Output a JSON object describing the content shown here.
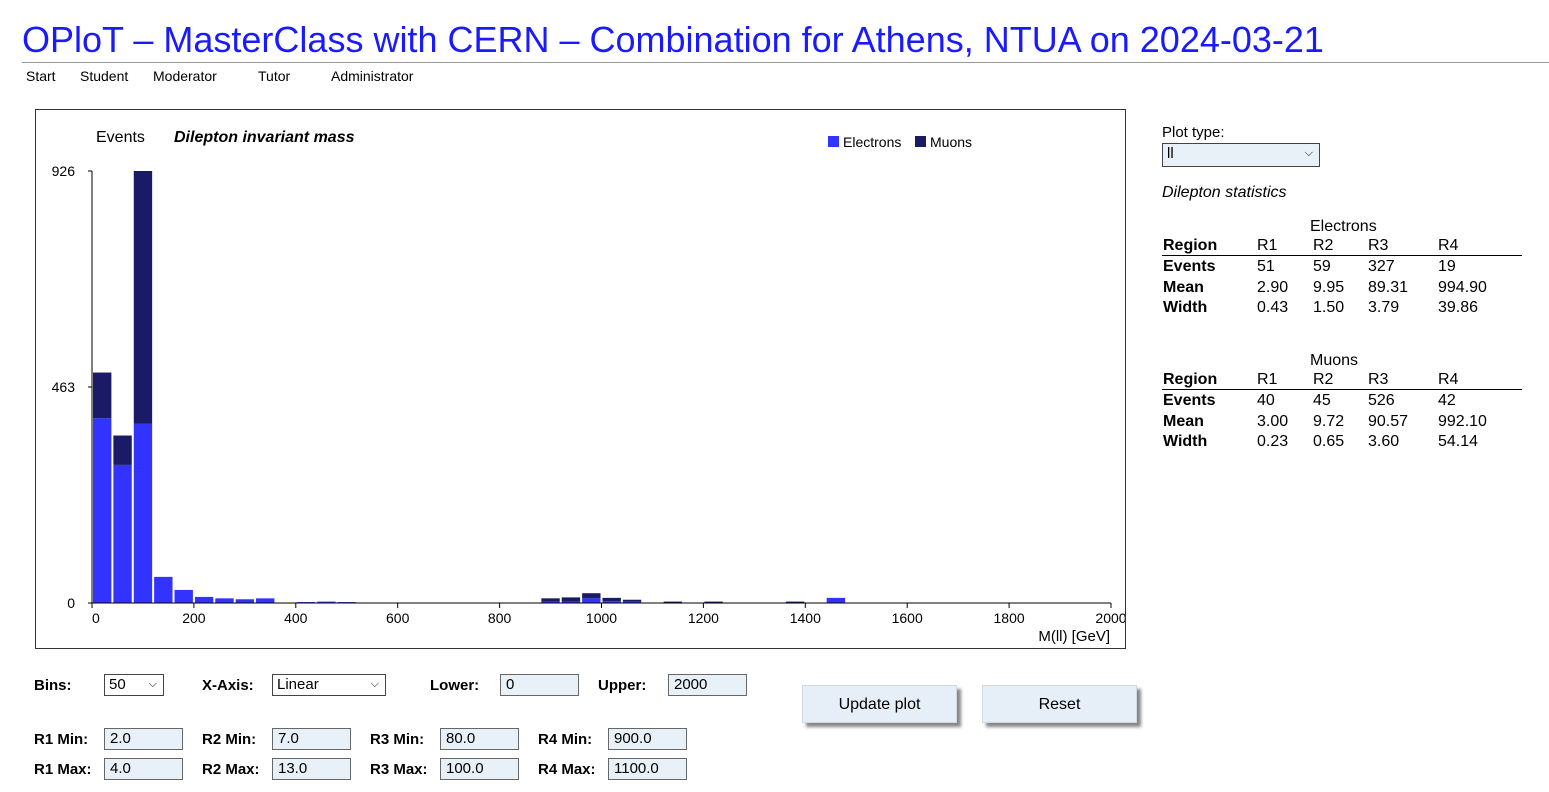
{
  "header": {
    "title": "OPloT – MasterClass with CERN – Combination for Athens, NTUA on 2024-03-21"
  },
  "nav": [
    "Start",
    "Student",
    "Moderator",
    "Tutor",
    "Administrator"
  ],
  "chart_data": {
    "type": "bar",
    "stacked": true,
    "title": "Dilepton invariant mass",
    "ylabel": "Events",
    "xlabel": "M(ll) [GeV]",
    "xlim": [
      0,
      2000
    ],
    "ylim": [
      0,
      926
    ],
    "xticks": [
      "0",
      "200",
      "400",
      "600",
      "800",
      "1000",
      "1200",
      "1400",
      "1600",
      "1800",
      "2000"
    ],
    "yticks": [
      "926",
      "463",
      "0"
    ],
    "bin_width": 40,
    "bin_starts": [
      0,
      40,
      80,
      120,
      160,
      200,
      240,
      280,
      320,
      360,
      400,
      440,
      480,
      880,
      920,
      960,
      1000,
      1040,
      1120,
      1200,
      1360,
      1440
    ],
    "legend_position": "top-right",
    "series": [
      {
        "name": "Electrons",
        "color": "#3333ff",
        "values": [
          396,
          296,
          384,
          56,
          28,
          13,
          10,
          8,
          10,
          1,
          2,
          3,
          2,
          3,
          3,
          10,
          4,
          3,
          1,
          1,
          1,
          11
        ]
      },
      {
        "name": "Muons",
        "color": "#1a1a66",
        "values": [
          98,
          63,
          542,
          0,
          0,
          0,
          0,
          0,
          0,
          0,
          0,
          0,
          0,
          7,
          9,
          11,
          7,
          4,
          2,
          2,
          2,
          0
        ]
      }
    ]
  },
  "right_panel": {
    "plot_type_label": "Plot type:",
    "plot_type_value": "ll",
    "stats_title": "Dilepton statistics",
    "tables": [
      {
        "caption": "Electrons",
        "columns": [
          "Region",
          "R1",
          "R2",
          "R3",
          "R4"
        ],
        "rows": [
          {
            "label": "Events",
            "values": [
              "51",
              "59",
              "327",
              "19"
            ]
          },
          {
            "label": "Mean",
            "values": [
              "2.90",
              "9.95",
              "89.31",
              "994.90"
            ]
          },
          {
            "label": "Width",
            "values": [
              "0.43",
              "1.50",
              "3.79",
              "39.86"
            ]
          }
        ]
      },
      {
        "caption": "Muons",
        "columns": [
          "Region",
          "R1",
          "R2",
          "R3",
          "R4"
        ],
        "rows": [
          {
            "label": "Events",
            "values": [
              "40",
              "45",
              "526",
              "42"
            ]
          },
          {
            "label": "Mean",
            "values": [
              "3.00",
              "9.72",
              "90.57",
              "992.10"
            ]
          },
          {
            "label": "Width",
            "values": [
              "0.23",
              "0.65",
              "3.60",
              "54.14"
            ]
          }
        ]
      }
    ]
  },
  "controls": {
    "bins_label": "Bins:",
    "bins_value": "50",
    "xaxis_label": "X-Axis:",
    "xaxis_value": "Linear",
    "lower_label": "Lower:",
    "lower_value": "0",
    "upper_label": "Upper:",
    "upper_value": "2000",
    "update_label": "Update plot",
    "reset_label": "Reset",
    "regions": [
      {
        "min_label": "R1 Min:",
        "min": "2.0",
        "max_label": "R1 Max:",
        "max": "4.0"
      },
      {
        "min_label": "R2 Min:",
        "min": "7.0",
        "max_label": "R2 Max:",
        "max": "13.0"
      },
      {
        "min_label": "R3 Min:",
        "min": "80.0",
        "max_label": "R3 Max:",
        "max": "100.0"
      },
      {
        "min_label": "R4 Min:",
        "min": "900.0",
        "max_label": "R4 Max:",
        "max": "1100.0"
      }
    ]
  }
}
